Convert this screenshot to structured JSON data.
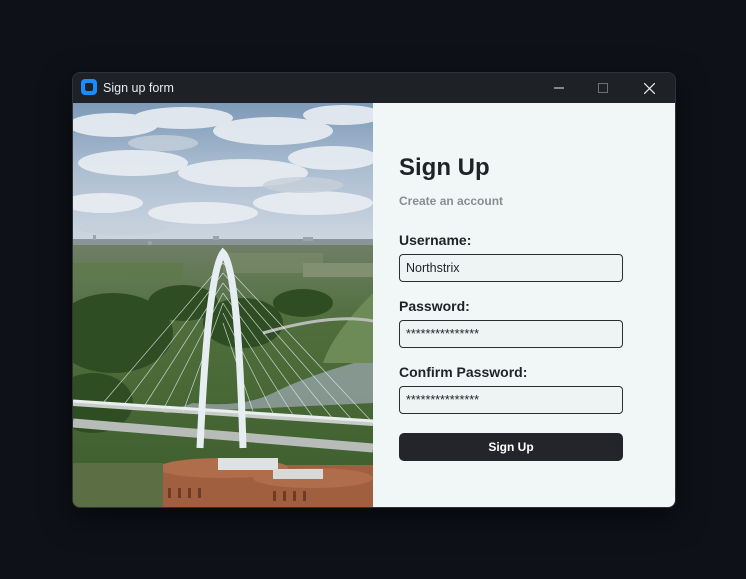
{
  "window": {
    "title": "Sign up form",
    "icon": "app-icon",
    "controls": [
      "minimize-icon",
      "maximize-icon",
      "close-icon"
    ]
  },
  "image": {
    "description_icon": "bridge-photo"
  },
  "form": {
    "title": "Sign Up",
    "subtitle": "Create an account",
    "username_label": "Username:",
    "username_value": "Northstrix",
    "password_label": "Password:",
    "password_value": "***************",
    "confirm_label": "Confirm Password:",
    "confirm_value": "***************",
    "submit_label": "Sign Up"
  },
  "colors": {
    "accent": "#1a8cff",
    "form_bg": "#f1f7f7",
    "button_bg": "#24252a",
    "window_bg": "#1e2226"
  }
}
